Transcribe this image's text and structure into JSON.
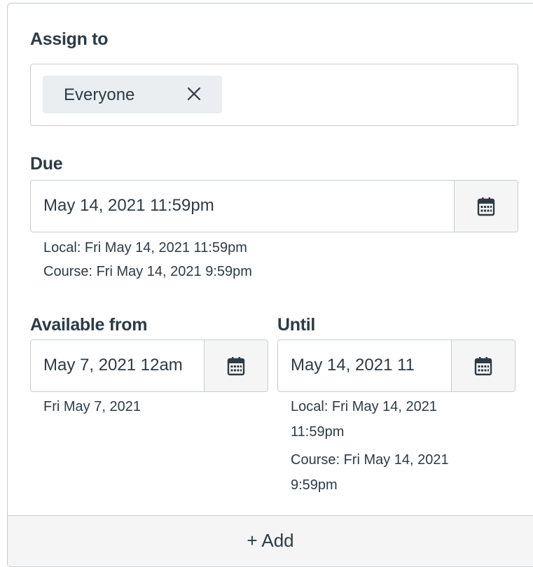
{
  "assign": {
    "label": "Assign to",
    "chip_label": "Everyone"
  },
  "due": {
    "label": "Due",
    "value": "May 14, 2021 11:59pm",
    "local": "Local: Fri May 14, 2021 11:59pm",
    "course": "Course: Fri May 14, 2021 9:59pm"
  },
  "available_from": {
    "label": "Available from",
    "value": "May 7, 2021 12am",
    "hint": "Fri May 7, 2021"
  },
  "until": {
    "label": "Until",
    "value": "May 14, 2021 11",
    "local_line1": "Local: Fri May 14, 2021",
    "local_line2": "11:59pm",
    "course_line1": "Course: Fri May 14, 2021",
    "course_line2": "9:59pm"
  },
  "add": {
    "label": "+ Add"
  },
  "icons": {
    "chip_remove": "close-icon",
    "calendar": "calendar-icon"
  }
}
